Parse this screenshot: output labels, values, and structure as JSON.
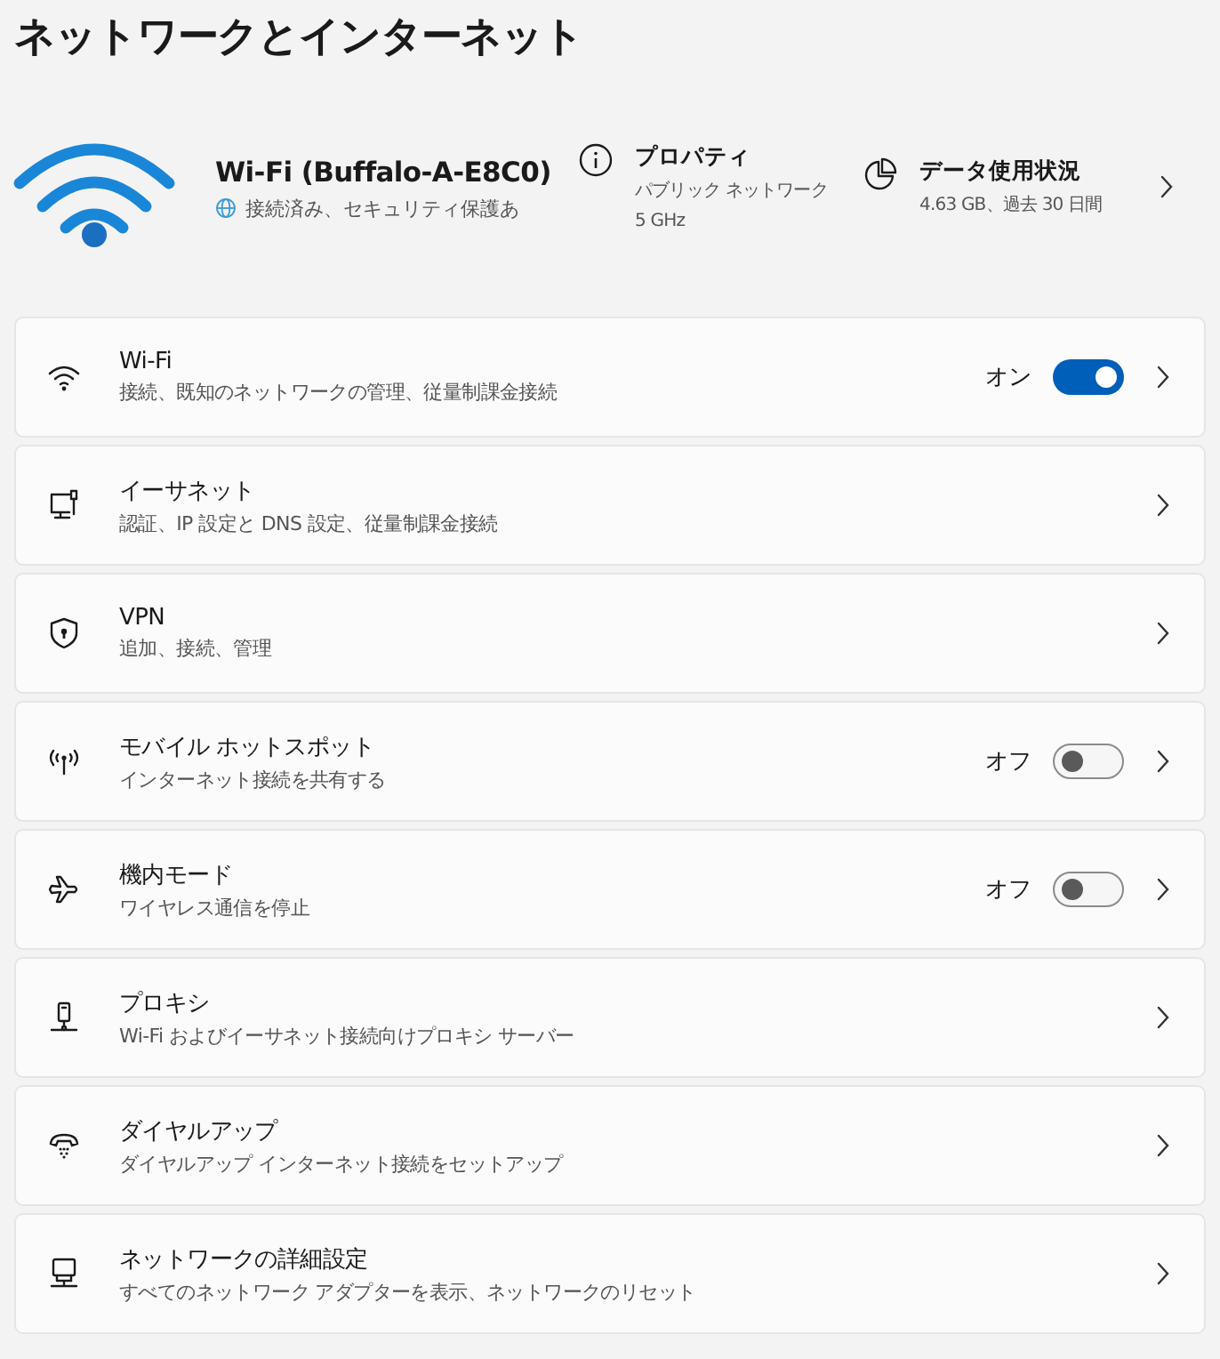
{
  "title": "ネットワークとインターネット",
  "connection": {
    "name": "Wi-Fi (Buffalo-A-E8C0)",
    "status": "接続済み、セキュリティ保護あ"
  },
  "properties": {
    "title": "プロパティ",
    "lines": [
      "パブリック ネットワーク",
      "5 GHz"
    ]
  },
  "data_usage": {
    "title": "データ使用状況",
    "detail": "4.63 GB、過去 30 日間"
  },
  "items": [
    {
      "title": "Wi-Fi",
      "subtitle": "接続、既知のネットワークの管理、従量制課金接続",
      "toggle": {
        "label": "オン",
        "on": true
      }
    },
    {
      "title": "イーサネット",
      "subtitle": "認証、IP 設定と DNS 設定、従量制課金接続"
    },
    {
      "title": "VPN",
      "subtitle": "追加、接続、管理"
    },
    {
      "title": "モバイル ホットスポット",
      "subtitle": "インターネット接続を共有する",
      "toggle": {
        "label": "オフ",
        "on": false
      }
    },
    {
      "title": "機内モード",
      "subtitle": "ワイヤレス通信を停止",
      "toggle": {
        "label": "オフ",
        "on": false
      }
    },
    {
      "title": "プロキシ",
      "subtitle": "Wi-Fi およびイーサネット接続向けプロキシ サーバー"
    },
    {
      "title": "ダイヤルアップ",
      "subtitle": "ダイヤルアップ インターネット接続をセットアップ"
    },
    {
      "title": "ネットワークの詳細設定",
      "subtitle": "すべてのネットワーク アダプターを表示、ネットワークのリセット"
    }
  ]
}
